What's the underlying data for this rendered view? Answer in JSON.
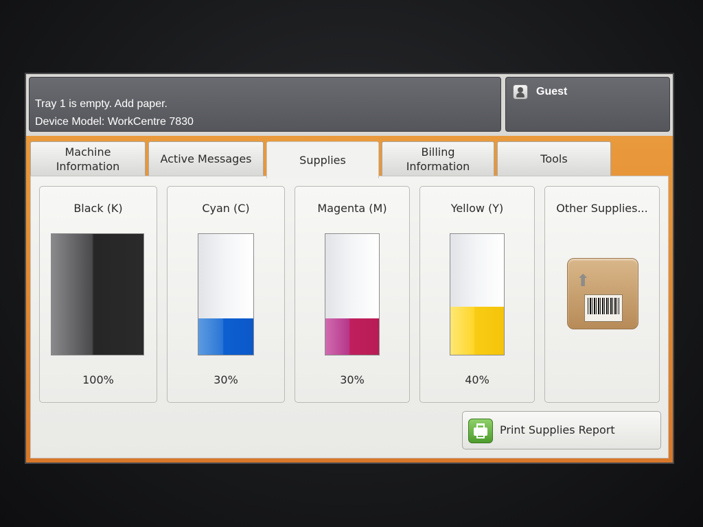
{
  "status": {
    "message": "Tray 1 is empty.  Add paper.",
    "device_model": "Device Model: WorkCentre 7830"
  },
  "user": {
    "name": "Guest",
    "icon": "user-icon"
  },
  "tabs": [
    {
      "label": "Machine\nInformation",
      "active": false
    },
    {
      "label": "Active Messages",
      "active": false
    },
    {
      "label": "Supplies",
      "active": true
    },
    {
      "label": "Billing\nInformation",
      "active": false
    },
    {
      "label": "Tools",
      "active": false
    }
  ],
  "supplies": [
    {
      "name": "Black (K)",
      "percent_label": "100%",
      "level": 1.0,
      "color": "#2a2a2a"
    },
    {
      "name": "Cyan (C)",
      "percent_label": "30%",
      "level": 0.3,
      "color": "#0c58c9"
    },
    {
      "name": "Magenta (M)",
      "percent_label": "30%",
      "level": 0.3,
      "color": "#b81c55"
    },
    {
      "name": "Yellow (Y)",
      "percent_label": "40%",
      "level": 0.4,
      "color": "#f4c40a"
    }
  ],
  "other_supplies": {
    "label": "Other Supplies...",
    "icon": "supplies-box-icon"
  },
  "print_report": {
    "label": "Print Supplies Report",
    "icon": "printer-icon"
  },
  "colors": {
    "accent": "#e0873a",
    "status_bar": "#5f6065"
  }
}
